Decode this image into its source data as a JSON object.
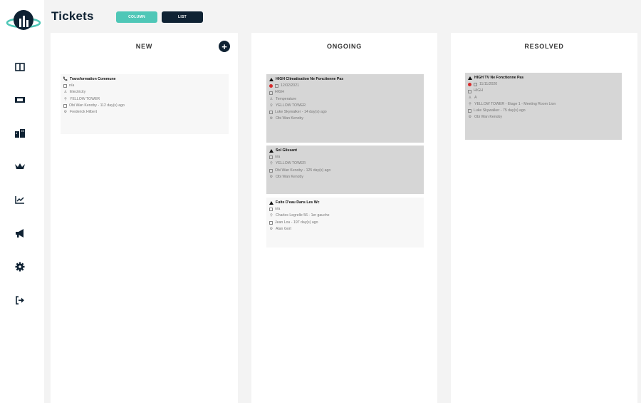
{
  "app": {
    "title": "Tickets"
  },
  "view_toggle": {
    "column_label": "COLUMN",
    "list_label": "LIST"
  },
  "sidebar": {
    "items": [
      {
        "icon": "dashboard-icon"
      },
      {
        "icon": "tickets-icon"
      },
      {
        "icon": "buildings-icon"
      },
      {
        "icon": "crown-icon"
      },
      {
        "icon": "chart-icon"
      },
      {
        "icon": "megaphone-icon"
      },
      {
        "icon": "gear-icon"
      },
      {
        "icon": "logout-icon"
      }
    ]
  },
  "columns": {
    "new": {
      "title": "NEW",
      "cards": [
        {
          "title": "Transformation Commune",
          "lines": [
            "n/a",
            "Electricity",
            "YELLOW TOWER",
            "Obi Wan Kenoby - 112 day(s) ago",
            "Frederick Hilbert"
          ]
        }
      ]
    },
    "ongoing": {
      "title": "ONGOING",
      "cards": [
        {
          "title": "HIGH Climatisation Ne Fonctionne Pas",
          "lines": [
            "12/02/2021",
            "HIGH",
            "Temperature",
            "YELLOW TOWER",
            "Luke Skywalker - 14 day(s) ago",
            "Obi Wan Kenoby"
          ]
        },
        {
          "title": "Sol Glissant",
          "lines": [
            "n/a",
            "YELLOW TOWER",
            "Obi Wan Kenoby - 125 day(s) ago",
            "Obi Wan Kenoby"
          ]
        },
        {
          "title": "Fuite D'eau Dans Les Wc",
          "lines": [
            "n/a",
            "Charles Legrelle 56 - 1er gauche",
            "Jean Lou - 197 day(s) ago",
            "Alan Gort"
          ]
        }
      ]
    },
    "resolved": {
      "title": "RESOLVED",
      "cards": [
        {
          "title": "HIGH TV Ne Fonctionne Pas",
          "lines": [
            "11/11/2020",
            "HIGH",
            "A",
            "YELLOW TOWER - Etage 1 - Meeting Room Lion",
            "Luke Skywalker - 75 day(s) ago",
            "Obi Wan Kenoby"
          ]
        }
      ]
    }
  }
}
